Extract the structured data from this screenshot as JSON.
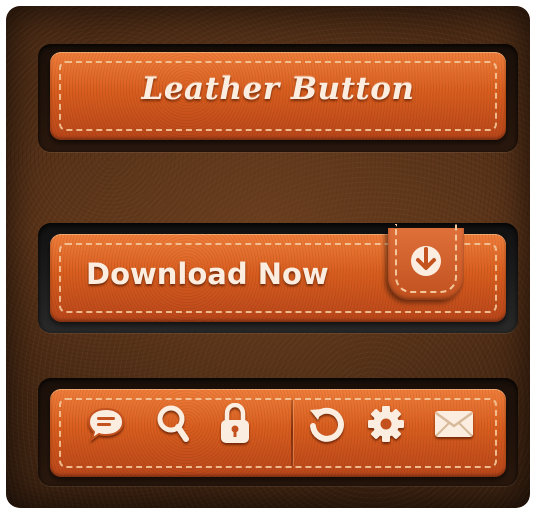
{
  "buttons": {
    "leather": {
      "label": "Leather Button"
    },
    "download": {
      "label": "Download Now",
      "icon": "arrow-down-icon"
    },
    "toolbar": {
      "icons": [
        "chat-bubble-icon",
        "search-icon",
        "lock-icon",
        "refresh-icon",
        "gear-icon",
        "mail-icon"
      ]
    }
  },
  "colors": {
    "leather": "#d85d1e",
    "stitch": "#f4c79a",
    "background": "#4a2a14",
    "text": "#fbeee0"
  }
}
